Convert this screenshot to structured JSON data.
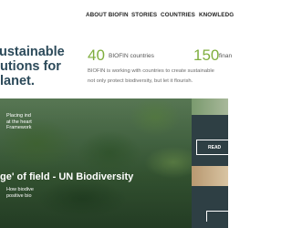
{
  "nav": {
    "items": [
      {
        "label": "ABOUT BIOFIN"
      },
      {
        "label": "STORIES"
      },
      {
        "label": "COUNTRIES"
      },
      {
        "label": "KNOWLEDG"
      }
    ]
  },
  "hero_intro": {
    "headline_lines": [
      "ustainable",
      "utions for",
      "lanet."
    ],
    "stats": [
      {
        "value": "40",
        "label": "BIOFIN countries"
      },
      {
        "value": "150",
        "label": "finan"
      }
    ],
    "intro_lines": [
      "BIOFIN is working with countries to create sustainable",
      "not only protect biodiversity, but let it flourish."
    ]
  },
  "feature": {
    "title": "ge' of field - UN Biodiversity"
  },
  "cards": [
    {
      "lines": [
        "Placing ind",
        "at the heart",
        "Framework"
      ],
      "button_label": "READ"
    },
    {
      "lines": [
        "How biodive",
        "positive bio"
      ]
    }
  ]
}
